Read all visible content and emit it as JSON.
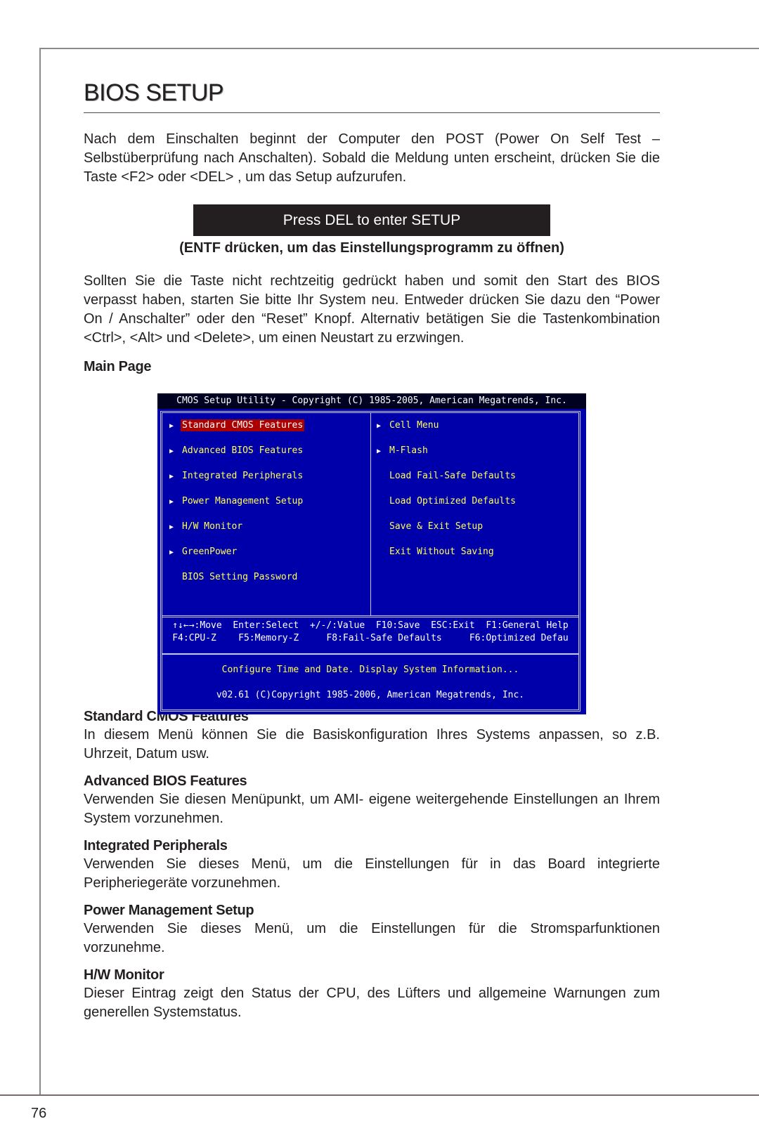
{
  "page": {
    "title": "BIOS SETUP",
    "intro": "Nach dem Einschalten beginnt der Computer den POST (Power On Self Test – Selbstüberprüfung nach Anschalten). Sobald die Meldung unten erscheint, drücken Sie die Taste <F2> oder <DEL> , um das Setup aufzurufen.",
    "press_box": "Press DEL to enter SETUP",
    "press_sub": "(ENTF drücken, um das Einstellungsprogramm zu öffnen)",
    "para2": "Sollten Sie die Taste nicht rechtzeitig gedrückt haben und somit den Start des BIOS verpasst haben, starten Sie bitte Ihr System neu. Entweder drücken Sie dazu den “Power On / Anschalter” oder den “Reset” Knopf. Alternativ betätigen Sie die Tastenkombination <Ctrl>, <Alt> und <Delete>, um einen Neustart zu erzwingen.",
    "main_page_label": "Main Page",
    "page_number": "76"
  },
  "bios": {
    "title": "CMOS Setup Utility - Copyright (C) 1985-2005, American Megatrends, Inc.",
    "left_items": [
      {
        "label": "Standard CMOS Features",
        "arrow": true,
        "selected": true
      },
      {
        "label": "Advanced BIOS Features",
        "arrow": true,
        "selected": false
      },
      {
        "label": "Integrated Peripherals",
        "arrow": true,
        "selected": false
      },
      {
        "label": "Power Management Setup",
        "arrow": true,
        "selected": false
      },
      {
        "label": "H/W Monitor",
        "arrow": true,
        "selected": false
      },
      {
        "label": "GreenPower",
        "arrow": true,
        "selected": false
      },
      {
        "label": "BIOS Setting Password",
        "arrow": false,
        "selected": false
      }
    ],
    "right_items": [
      {
        "label": "Cell Menu",
        "arrow": true
      },
      {
        "label": "M-Flash",
        "arrow": true
      },
      {
        "label": "Load Fail-Safe Defaults",
        "arrow": false
      },
      {
        "label": "Load Optimized Defaults",
        "arrow": false
      },
      {
        "label": "Save & Exit Setup",
        "arrow": false
      },
      {
        "label": "Exit Without Saving",
        "arrow": false
      }
    ],
    "keys_line1": "↑↓←→:Move  Enter:Select  +/-/:Value  F10:Save  ESC:Exit  F1:General Help",
    "keys_line2": "F4:CPU-Z    F5:Memory-Z     F8:Fail-Safe Defaults     F6:Optimized Defau",
    "description": "Configure Time and Date.  Display System Information...",
    "version": "v02.61 (C)Copyright 1985-2006, American Megatrends, Inc."
  },
  "sections": [
    {
      "heading": "Standard CMOS Features",
      "text": "In diesem Menü können Sie die Basiskonfiguration Ihres Systems anpassen, so z.B. Uhrzeit, Datum usw."
    },
    {
      "heading": "Advanced BIOS Features",
      "text": "Verwenden Sie diesen Menüpunkt, um AMI- eigene weitergehende Einstellungen an Ihrem System vorzunehmen."
    },
    {
      "heading": "Integrated Peripherals",
      "text": "Verwenden Sie dieses Menü, um die Einstellungen für in das Board integrierte Peripheriegeräte vorzunehmen."
    },
    {
      "heading": "Power Management Setup",
      "text": "Verwenden Sie dieses Menü, um die Einstellungen für die Stromsparfunktionen vorzunehme."
    },
    {
      "heading": "H/W Monitor",
      "text": "Dieser Eintrag zeigt den Status der CPU, des Lüfters und allgemeine Warnungen zum generellen Systemstatus."
    }
  ]
}
